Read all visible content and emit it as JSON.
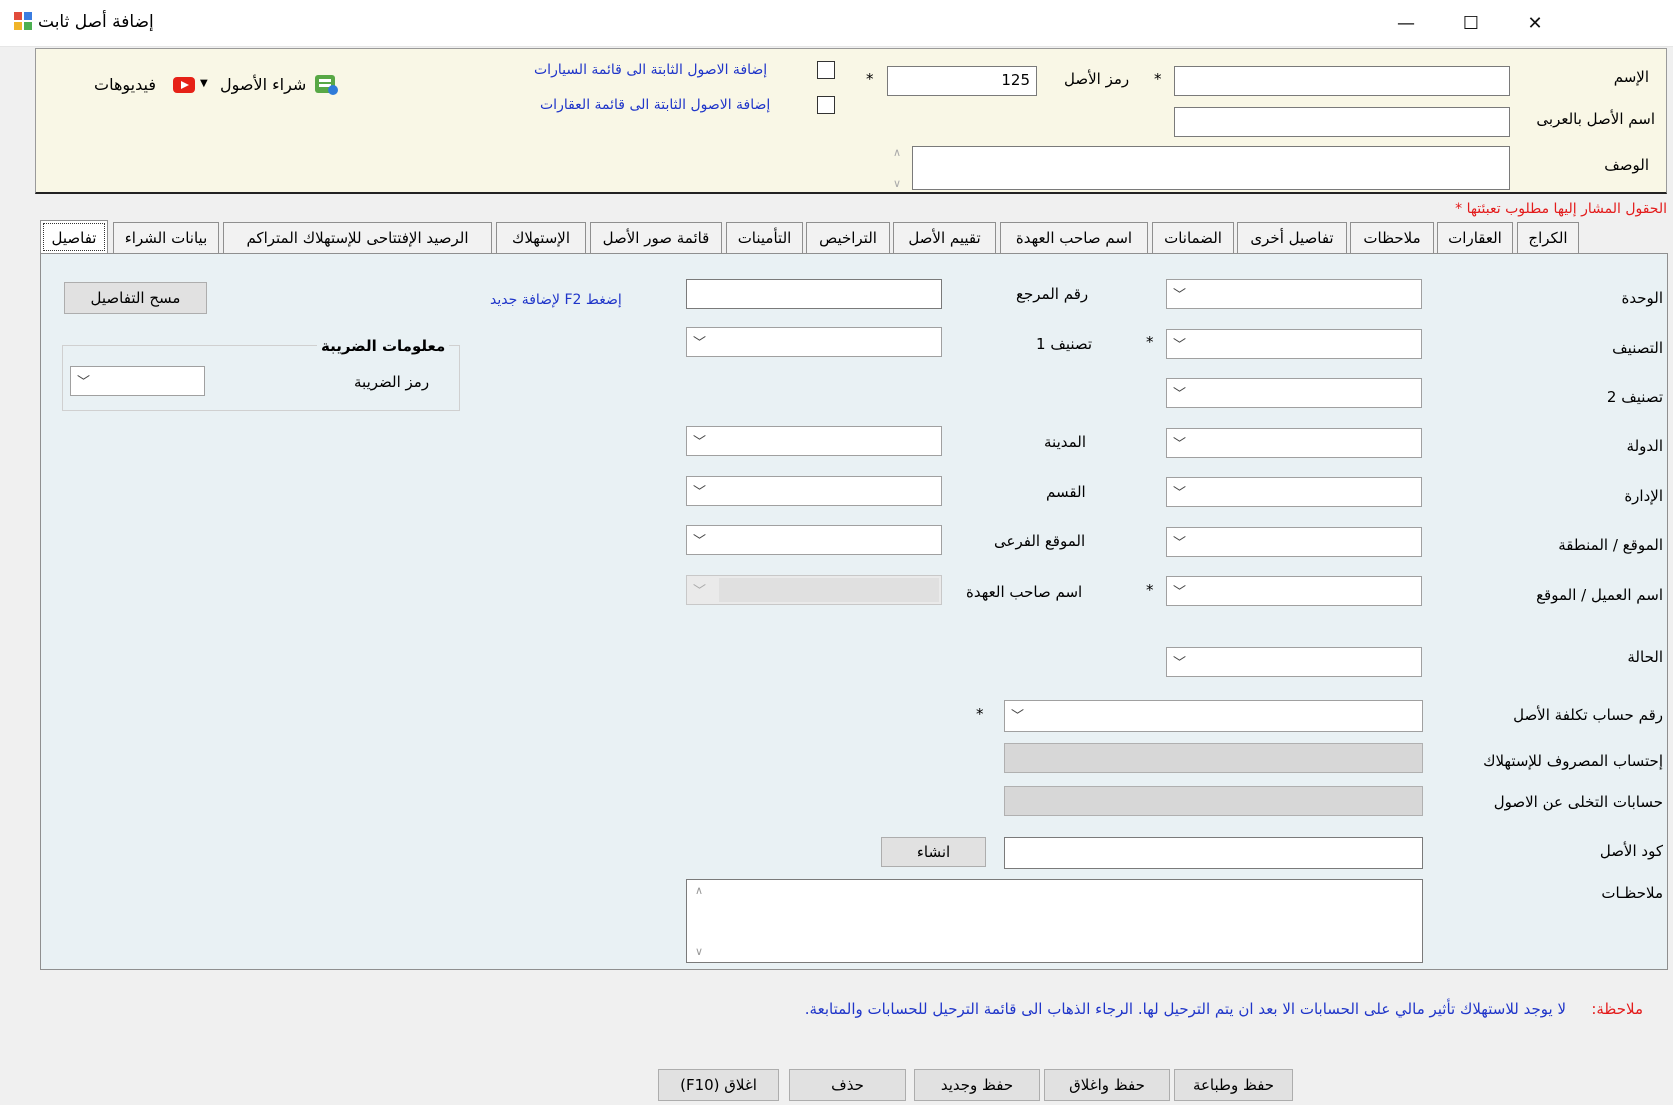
{
  "window": {
    "title": "إضافة أصل ثابت",
    "minimize": "—",
    "maximize": "☐",
    "close": "✕"
  },
  "header": {
    "name_label": "الإسم",
    "arabic_name_label": "اسم الأصل بالعربى",
    "description_label": "الوصف",
    "asset_code_label": "رمز الأصل",
    "asset_code_value": "125",
    "required_mark": "*",
    "add_to_cars_label": "إضافة الاصول الثابتة الى قائمة السيارات",
    "add_to_realestate_label": "إضافة الاصول الثابتة الى قائمة العقارات",
    "purchase_assets_label": "شراء الأصول",
    "videos_label": "فيديوهات"
  },
  "required_note": "الحقول المشار إليها مطلوب تعبئتها *",
  "tabs": [
    {
      "label": "الكراج"
    },
    {
      "label": "العقارات"
    },
    {
      "label": "ملاحظات"
    },
    {
      "label": "تفاصيل أخرى"
    },
    {
      "label": "الضمانات"
    },
    {
      "label": "اسم صاحب العهدة"
    },
    {
      "label": "تقييم الأصل"
    },
    {
      "label": "التراخيص"
    },
    {
      "label": "التأمينات"
    },
    {
      "label": "قائمة صور الأصل"
    },
    {
      "label": "الإستهلاك"
    },
    {
      "label": "الرصيد الإفتتاحى للإستهلاك المتراكم"
    },
    {
      "label": "بيانات الشراء"
    },
    {
      "label": "تفاصيل"
    }
  ],
  "details": {
    "unit_label": "الوحدة",
    "category_label": "التصنيف",
    "category2_label": "تصنيف 2",
    "country_label": "الدولة",
    "department_label": "الإدارة",
    "location_label": "الموقع / المنطقة",
    "client_label": "اسم العميل / الموقع",
    "status_label": "الحالة",
    "reference_label": "رقم المرجع",
    "category1_label": "تصنيف 1",
    "city_label": "المدينة",
    "section_label": "القسم",
    "sublocation_label": "الموقع الفرعى",
    "custodian_label": "اسم صاحب العهدة",
    "f2_hint": "إضغط F2 لإضافة جديد",
    "clear_details_button": "مسح التفاصيل",
    "tax_group_title": "معلومات الضريبة",
    "tax_code_label": "رمز الضريبة",
    "cost_account_label": "رقم حساب تكلفة الأصل",
    "depreciation_expense_label": "إحتساب المصروف للإستهلاك",
    "disposal_accounts_label": "حسابات التخلى عن الاصول",
    "asset_code_label": "كود الأصل",
    "create_button": "انشاء",
    "notes_label": "ملاحظـات"
  },
  "footer": {
    "note_prefix": "ملاحظة:",
    "note_text": "لا يوجد للاستهلاك تأثير مالي على الحسابات الا بعد ان يتم الترحيل لها. الرجاء الذهاب الى قائمة الترحيل للحسابات والمتابعة.",
    "save_print": "حفظ وطباعة",
    "save_close": "حفظ واغلاق",
    "save_new": "حفظ وجديد",
    "delete": "حذف",
    "close": "اغلاق (F10)"
  },
  "icons": {
    "app_icon": "app-icon",
    "chevron": "chevron-down-icon",
    "youtube": "youtube-icon",
    "purchase": "purchase-assets-icon"
  },
  "colors": {
    "header_bg": "#f9f7e6",
    "content_bg": "#e9f1f4",
    "link_blue": "#1f35c9",
    "required_red": "#e31b1b"
  }
}
